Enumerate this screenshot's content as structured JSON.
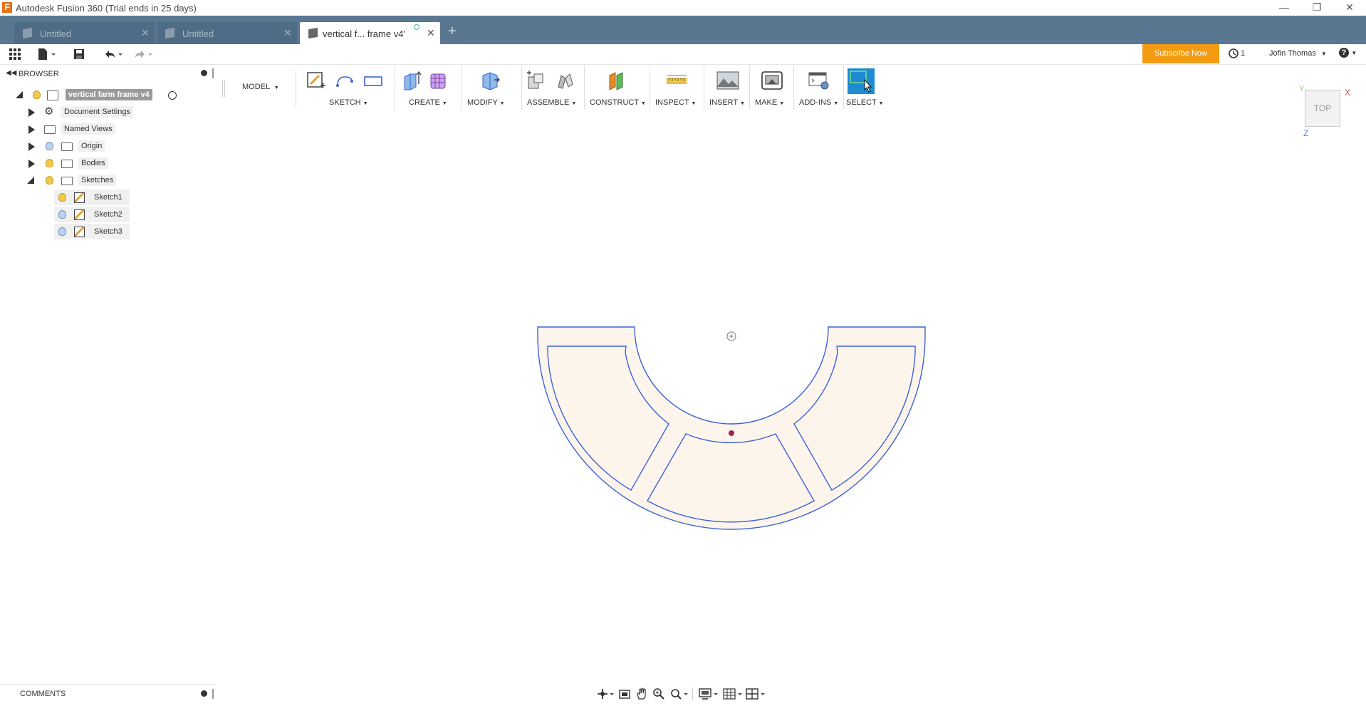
{
  "app": {
    "title": "Autodesk Fusion 360 (Trial ends in 25 days)",
    "logo_letter": "F"
  },
  "tabs": [
    {
      "label": "Untitled",
      "active": false
    },
    {
      "label": "Untitled",
      "active": false
    },
    {
      "label": "vertical f... frame v4'",
      "active": true
    }
  ],
  "quick_access": {
    "subscribe_label": "Subscribe Now",
    "jobs_count": "1",
    "user_name": "Jofin Thomas",
    "help_label": "?"
  },
  "browser": {
    "header": "BROWSER",
    "root_label": "vertical farm frame v4",
    "items": [
      {
        "label": "Document Settings"
      },
      {
        "label": "Named Views"
      },
      {
        "label": "Origin"
      },
      {
        "label": "Bodies"
      },
      {
        "label": "Sketches"
      }
    ],
    "sketches": [
      {
        "label": "Sketch1"
      },
      {
        "label": "Sketch2"
      },
      {
        "label": "Sketch3"
      }
    ]
  },
  "toolbar": {
    "workspace": "MODEL",
    "groups": [
      {
        "label": "SKETCH"
      },
      {
        "label": "CREATE"
      },
      {
        "label": "MODIFY"
      },
      {
        "label": "ASSEMBLE"
      },
      {
        "label": "CONSTRUCT"
      },
      {
        "label": "INSPECT"
      },
      {
        "label": "INSERT"
      },
      {
        "label": "MAKE"
      },
      {
        "label": "ADD-INS"
      },
      {
        "label": "SELECT"
      }
    ]
  },
  "viewcube": {
    "face": "TOP",
    "axis_x": "X",
    "axis_y": "Y",
    "axis_z": "Z"
  },
  "comments": {
    "header": "COMMENTS"
  },
  "colors": {
    "tab_bar": "#5a7791",
    "subscribe": "#f39c12",
    "sketch_line": "#3b63d8",
    "sketch_fill": "#fdf5ec",
    "select_active": "#1e8bd3"
  }
}
